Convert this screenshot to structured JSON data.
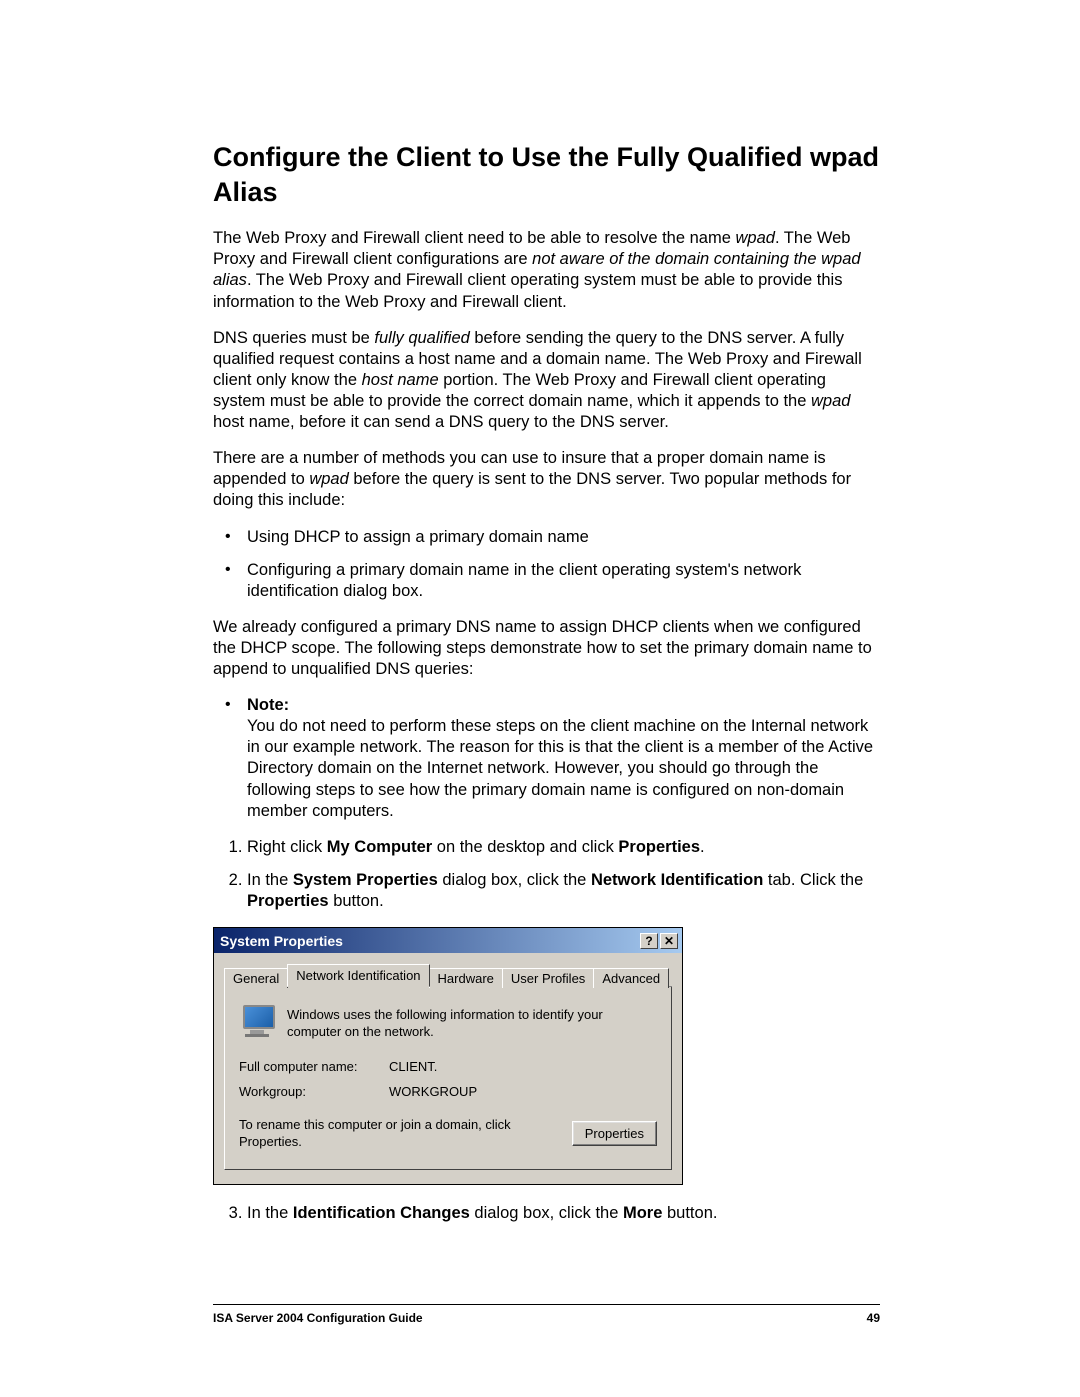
{
  "heading": "Configure the Client to Use the Fully Qualified wpad Alias",
  "para1_a": "The Web Proxy and Firewall client need to be able to resolve the name ",
  "para1_i1": "wpad",
  "para1_b": ". The Web Proxy and Firewall client configurations are ",
  "para1_i2": "not aware of the domain containing the wpad alias",
  "para1_c": ". The Web Proxy and Firewall client operating system must be able to provide this information to the Web Proxy and Firewall client.",
  "para2_a": "DNS queries must be ",
  "para2_i1": "fully qualified",
  "para2_b": " before sending the query to the DNS server. A fully qualified request contains a host name and a domain name. The Web Proxy and Firewall client only know the ",
  "para2_i2": "host name",
  "para2_c": " portion. The Web Proxy and Firewall client operating system must be able to provide the correct domain name, which it appends to the ",
  "para2_i3": "wpad",
  "para2_d": " host name, before it can send a DNS query to the DNS server.",
  "para3_a": "There are a number of methods you can use to insure that a proper domain name is appended to ",
  "para3_i1": "wpad",
  "para3_b": " before the query is sent to the DNS server. Two popular methods for doing this include:",
  "bullet1": "Using DHCP to assign a primary domain name",
  "bullet2": "Configuring a primary domain name in the client operating system's network identification dialog box.",
  "para4": "We already configured a primary DNS name to assign DHCP clients when we configured the DHCP scope. The following steps demonstrate how to set the primary domain name to append to unqualified DNS queries:",
  "note_label": "Note:",
  "note_body": "You do not need to perform these steps on the client machine on the Internal network in our example network. The reason for this is that the client is a member of the Active Directory domain on the Internet network. However, you should go through the following steps to see how the primary domain name is configured on non-domain member computers.",
  "step1_a": "Right click ",
  "step1_b1": "My Computer",
  "step1_b": " on the desktop and click ",
  "step1_b2": "Properties",
  "step1_c": ".",
  "step2_a": "In the ",
  "step2_b1": "System Properties",
  "step2_b": " dialog box, click the ",
  "step2_b2": "Network Identification",
  "step2_c": " tab. Click the ",
  "step2_b3": "Properties",
  "step2_d": " button.",
  "step3_a": "In the ",
  "step3_b1": "Identification Changes",
  "step3_b": " dialog box, click the ",
  "step3_b2": "More",
  "step3_c": " button.",
  "dialog": {
    "title": "System Properties",
    "help_glyph": "?",
    "close_glyph": "✕",
    "tabs": {
      "general": "General",
      "network_id": "Network Identification",
      "hardware": "Hardware",
      "user_profiles": "User Profiles",
      "advanced": "Advanced"
    },
    "info_text": "Windows uses the following information to identify your computer on the network.",
    "full_name_label": "Full computer name:",
    "full_name_value": "CLIENT.",
    "workgroup_label": "Workgroup:",
    "workgroup_value": "WORKGROUP",
    "rename_text": "To rename this computer or join a domain, click Properties.",
    "properties_btn": "Properties"
  },
  "footer": {
    "left": "ISA Server 2004 Configuration Guide",
    "right": "49"
  }
}
